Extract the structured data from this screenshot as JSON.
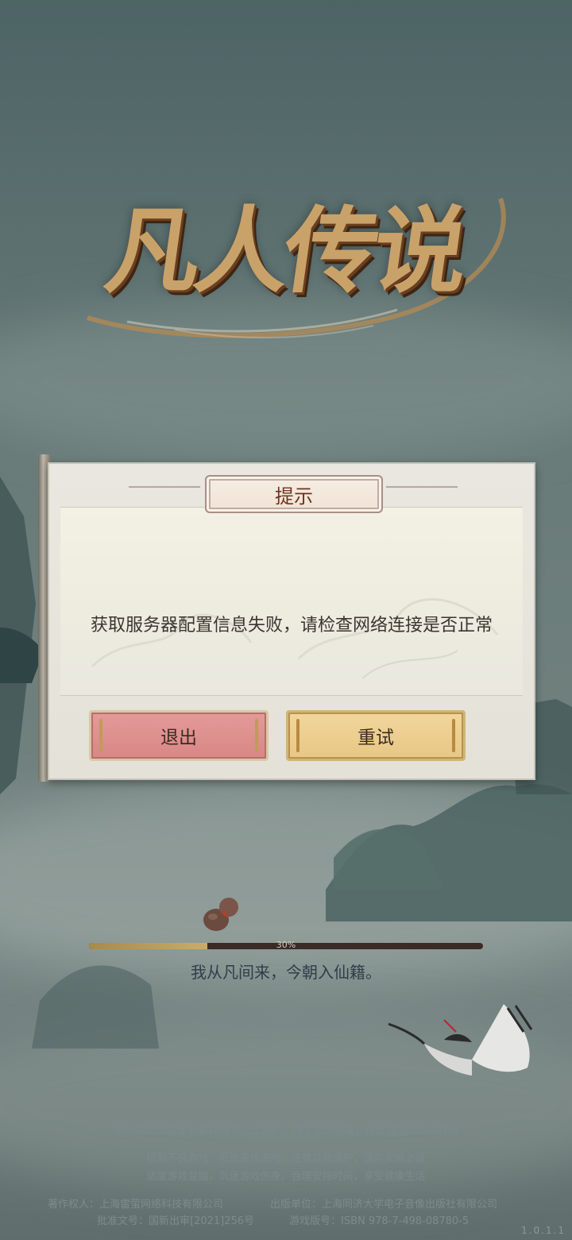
{
  "logo": {
    "title": "凡人传说"
  },
  "dialog": {
    "title": "提示",
    "message": "获取服务器配置信息失败，请检查网络连接是否正常",
    "exit_label": "退出",
    "retry_label": "重试"
  },
  "loading": {
    "progress_percent": 30,
    "progress_label": "30%",
    "tip": "我从凡间来，今朝入仙籍。"
  },
  "footer": {
    "notice": "本网络游戏适合年满18周岁以上用户，为了您的健康，请合理控制游戏时间",
    "health_line1": "抵制不良游戏，拒绝盗版游戏。注意自我保护，谨防受骗上当",
    "health_line2": "适度游戏益脑，沉迷游戏伤身。合理安排时间，享受健康生活",
    "copyright": "著作权人：上海雷萤网络科技有限公司",
    "publisher": "出版单位：上海同济大学电子音像出版社有限公司",
    "approval": "批准文号：国新出审[2021]256号",
    "isbn": "游戏版号：ISBN 978-7-498-08780-5",
    "version": "1.0.1.1"
  },
  "colors": {
    "exit_button": "#d88785",
    "retry_button": "#e8c785",
    "progress_fill": "#c9ad66"
  }
}
